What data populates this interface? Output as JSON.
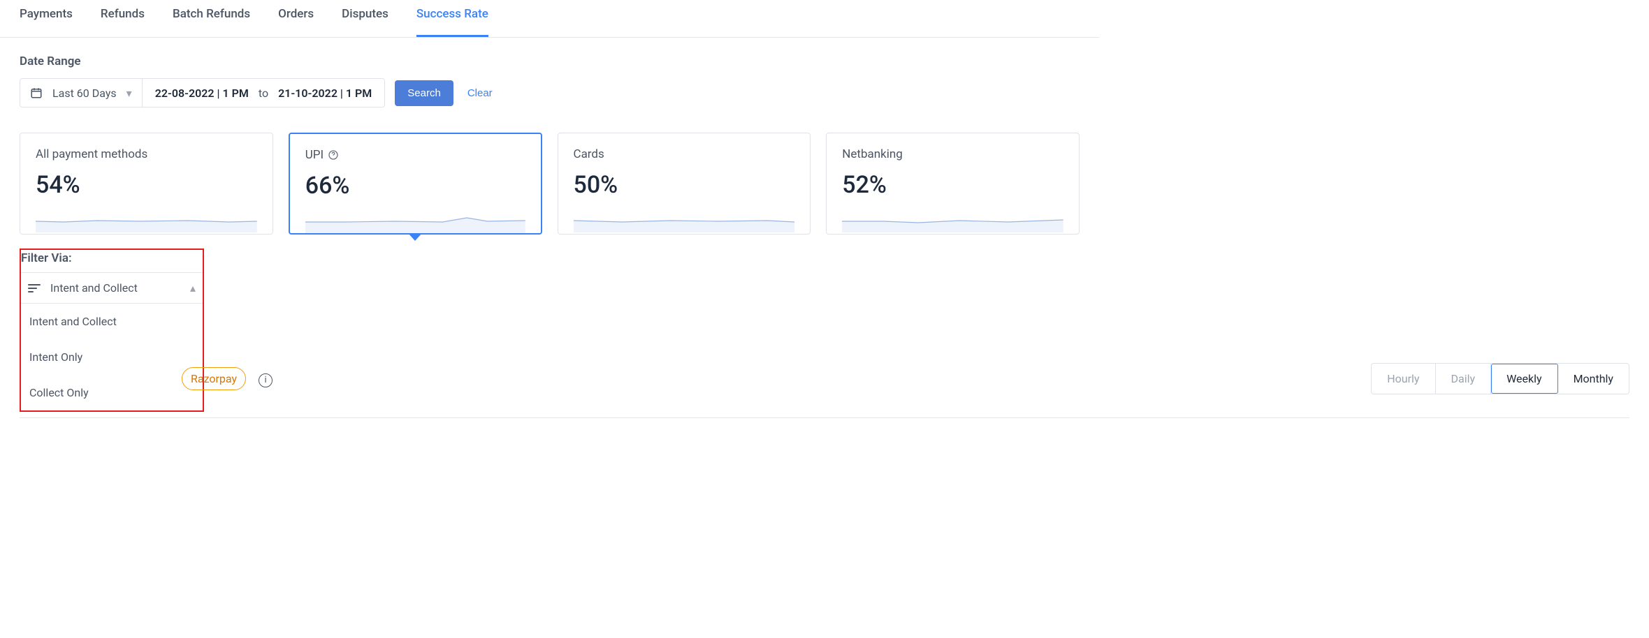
{
  "tabs": [
    {
      "label": "Payments",
      "active": false
    },
    {
      "label": "Refunds",
      "active": false
    },
    {
      "label": "Batch Refunds",
      "active": false
    },
    {
      "label": "Orders",
      "active": false
    },
    {
      "label": "Disputes",
      "active": false
    },
    {
      "label": "Success Rate",
      "active": true
    }
  ],
  "dateRange": {
    "label": "Date Range",
    "preset": "Last 60 Days",
    "from": "22-08-2022 | 1 PM",
    "to_label": "to",
    "to": "21-10-2022 | 1 PM",
    "searchLabel": "Search",
    "clearLabel": "Clear"
  },
  "cards": [
    {
      "title": "All payment methods",
      "value": "54%",
      "hasHelp": false,
      "active": false
    },
    {
      "title": "UPI",
      "value": "66%",
      "hasHelp": true,
      "active": true
    },
    {
      "title": "Cards",
      "value": "50%",
      "hasHelp": false,
      "active": false
    },
    {
      "title": "Netbanking",
      "value": "52%",
      "hasHelp": false,
      "active": false
    }
  ],
  "filter": {
    "label": "Filter Via:",
    "selected": "Intent and Collect",
    "options": [
      "Intent and Collect",
      "Intent Only",
      "Collect Only"
    ]
  },
  "bottom": {
    "chipLabel": "Razorpay",
    "timeSegments": [
      {
        "label": "Hourly",
        "state": "disabled"
      },
      {
        "label": "Daily",
        "state": "disabled"
      },
      {
        "label": "Weekly",
        "state": "active"
      },
      {
        "label": "Monthly",
        "state": "enabled"
      }
    ]
  }
}
